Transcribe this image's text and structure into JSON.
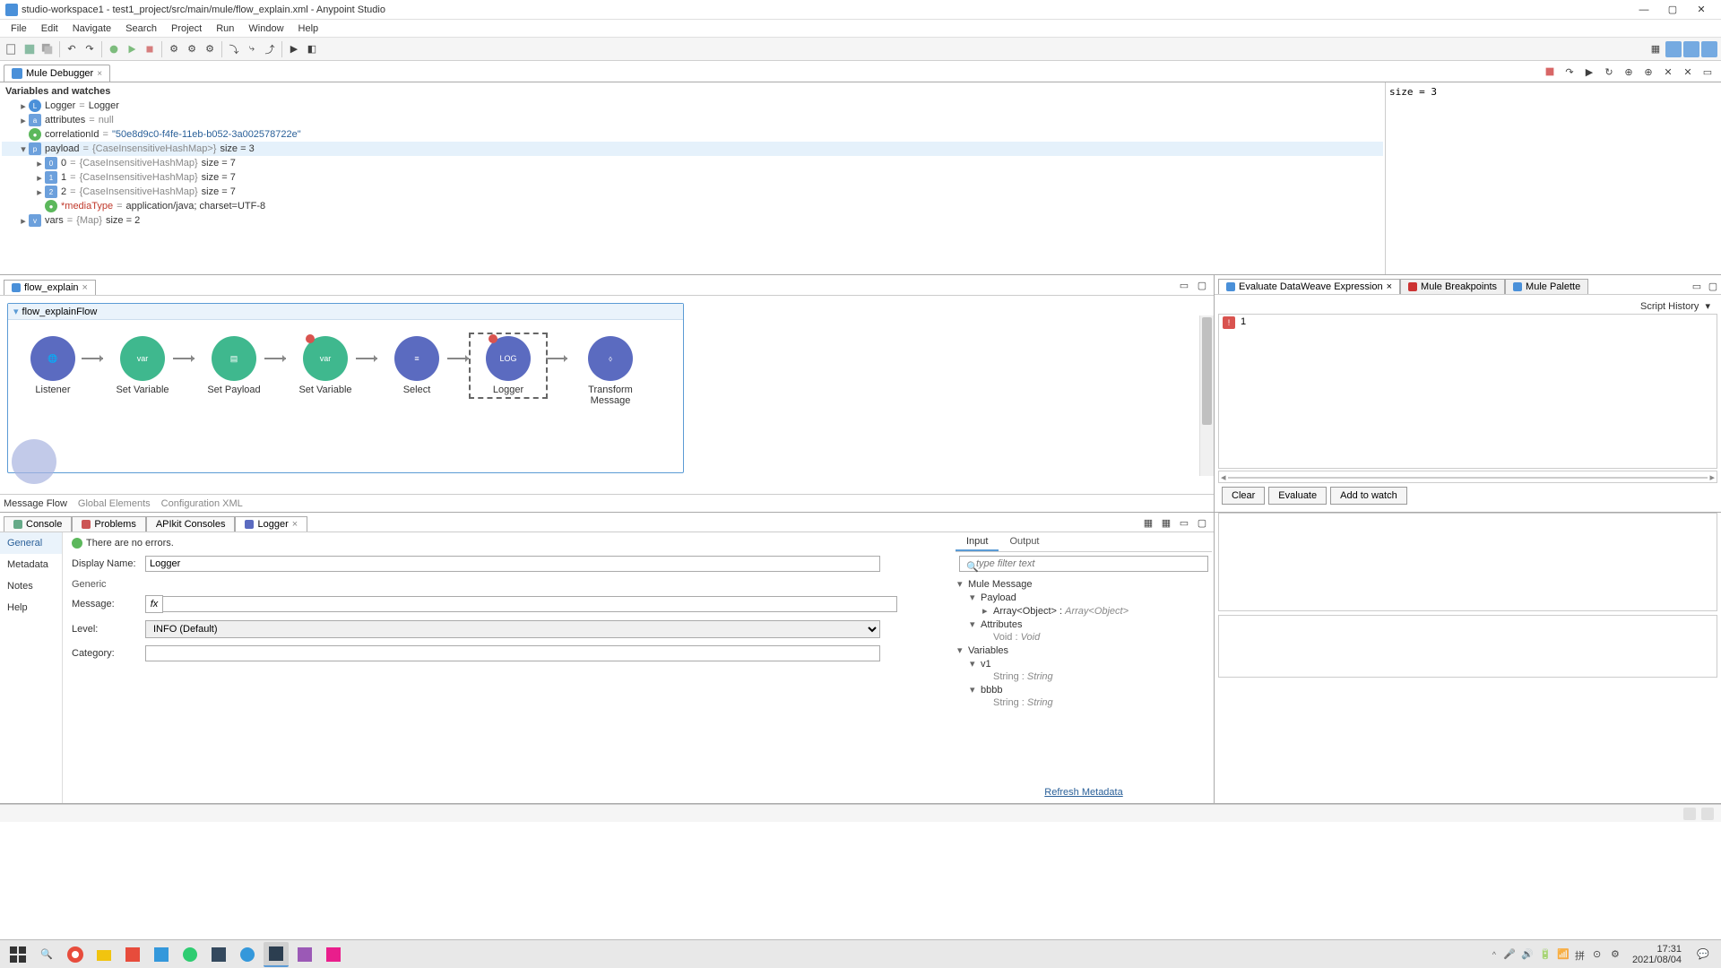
{
  "window": {
    "title": "studio-workspace1 - test1_project/src/main/mule/flow_explain.xml - Anypoint Studio"
  },
  "menu": [
    "File",
    "Edit",
    "Navigate",
    "Search",
    "Project",
    "Run",
    "Window",
    "Help"
  ],
  "debugger": {
    "tab": "Mule Debugger",
    "section_title": "Variables and watches",
    "watch_value": "size = 3",
    "tree": {
      "logger": {
        "key": "Logger",
        "val": "Logger"
      },
      "attributes": {
        "key": "attributes",
        "val": "null"
      },
      "correlationId": {
        "key": "correlationId",
        "val": "\"50e8d9c0-f4fe-11eb-b052-3a002578722e\""
      },
      "payload": {
        "key": "payload",
        "type": "{CaseInsensitiveHashMap>}",
        "size": "size = 3"
      },
      "p0": {
        "key": "0",
        "type": "{CaseInsensitiveHashMap}",
        "size": "size = 7"
      },
      "p1": {
        "key": "1",
        "type": "{CaseInsensitiveHashMap}",
        "size": "size = 7"
      },
      "p2": {
        "key": "2",
        "type": "{CaseInsensitiveHashMap}",
        "size": "size = 7"
      },
      "mediaType": {
        "key": "*mediaType",
        "val": "application/java; charset=UTF-8"
      },
      "vars": {
        "key": "vars",
        "type": "{Map}",
        "size": "size = 2"
      }
    }
  },
  "flow": {
    "tab": "flow_explain",
    "box_title": "flow_explainFlow",
    "nodes": {
      "listener": "Listener",
      "setvar1": "Set Variable",
      "setpayload": "Set Payload",
      "setvar2": "Set Variable",
      "select": "Select",
      "logger": "Logger",
      "transform": "Transform Message"
    },
    "canvas_tabs": [
      "Message Flow",
      "Global Elements",
      "Configuration XML"
    ]
  },
  "eval": {
    "tabs": [
      "Evaluate DataWeave Expression",
      "Mule Breakpoints",
      "Mule Palette"
    ],
    "script_history": "Script History",
    "line_no": "1",
    "buttons": {
      "clear": "Clear",
      "evaluate": "Evaluate",
      "add": "Add to watch"
    }
  },
  "bottom_tabs": {
    "console": "Console",
    "problems": "Problems",
    "apikit": "APIkit Consoles",
    "logger": "Logger"
  },
  "props": {
    "side": [
      "General",
      "Metadata",
      "Notes",
      "Help"
    ],
    "no_errors": "There are no errors.",
    "generic": "Generic",
    "display_name_label": "Display Name:",
    "display_name": "Logger",
    "message_label": "Message:",
    "message": "",
    "level_label": "Level:",
    "level": "INFO (Default)",
    "category_label": "Category:",
    "category": ""
  },
  "meta": {
    "tabs": [
      "Input",
      "Output"
    ],
    "filter_placeholder": "type filter text",
    "tree": {
      "mule_message": "Mule Message",
      "payload": "Payload",
      "array_obj": "Array<Object> :",
      "array_obj_t": "Array<Object>",
      "attributes": "Attributes",
      "void": "Void :",
      "void_t": "Void",
      "variables": "Variables",
      "v1": "v1",
      "string": "String :",
      "string_t": "String",
      "bbbb": "bbbb"
    },
    "refresh": "Refresh Metadata"
  },
  "taskbar": {
    "time": "17:31",
    "date": "2021/08/04"
  }
}
